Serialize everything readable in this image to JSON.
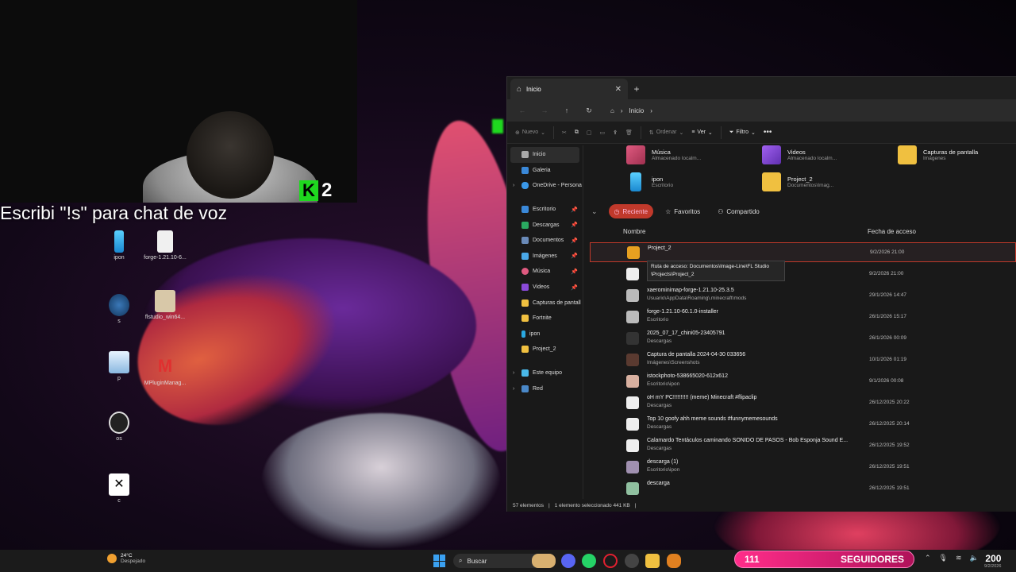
{
  "overlay": {
    "chat_text": "Escribi \"!s\" para chat de voz",
    "k_number": "2",
    "followers_count": "111",
    "followers_label": "SEGUIDORES",
    "right_count": "200"
  },
  "desktop": {
    "icons": [
      {
        "label": "ipon"
      },
      {
        "label": "forge-1.21.10-6..."
      },
      {
        "label": "s"
      },
      {
        "label": "flstudio_win64..."
      },
      {
        "label": "p"
      },
      {
        "label": "MPluginManag..."
      },
      {
        "label": "os"
      },
      {
        "label": "c"
      }
    ]
  },
  "explorer": {
    "tab_title": "Inicio",
    "breadcrumb": "Inicio",
    "toolbar": {
      "new": "Nuevo",
      "sort": "Ordenar",
      "view": "Ver",
      "filter": "Filtro"
    },
    "sidebar": {
      "items": [
        {
          "label": "Inicio",
          "pinned": false
        },
        {
          "label": "Galeria",
          "pinned": false
        },
        {
          "label": "OneDrive - Persona",
          "pinned": false
        },
        {
          "label": "Escritorio",
          "pinned": true
        },
        {
          "label": "Descargas",
          "pinned": true
        },
        {
          "label": "Documentos",
          "pinned": true
        },
        {
          "label": "Imágenes",
          "pinned": true
        },
        {
          "label": "Música",
          "pinned": true
        },
        {
          "label": "Videos",
          "pinned": true
        },
        {
          "label": "Capturas de pantall",
          "pinned": false
        },
        {
          "label": "Fortnite",
          "pinned": false
        },
        {
          "label": "ipon",
          "pinned": false
        },
        {
          "label": "Project_2",
          "pinned": false
        },
        {
          "label": "Este equipo",
          "pinned": false
        },
        {
          "label": "Red",
          "pinned": false
        }
      ]
    },
    "quick_access": [
      {
        "name": "Música",
        "sub": "Almacenado localm...",
        "color": "#c0407a"
      },
      {
        "name": "Videos",
        "sub": "Almacenado localm...",
        "color": "#8a3ad8"
      },
      {
        "name": "Capturas de pantalla",
        "sub": "Imágenes",
        "color": "#f0c040"
      },
      {
        "name": "ipon",
        "sub": "Escritorio",
        "color": "#2aa8e0"
      },
      {
        "name": "Project_2",
        "sub": "Documentos\\Imag...",
        "color": "#f0c040"
      }
    ],
    "filters": {
      "recent": "Reciente",
      "favorites": "Favoritos",
      "shared": "Compartido"
    },
    "columns": {
      "name": "Nombre",
      "date": "Fecha de acceso"
    },
    "files": [
      {
        "name": "Project_2",
        "location": "",
        "date": "9/2/2026 21:00",
        "color": "#e8a020"
      },
      {
        "name": "",
        "location": "Documentos\\Image-Line\\FL Studio\\Projects\\Project_2",
        "date": "9/2/2026 21:00",
        "color": "#eeeeee"
      },
      {
        "name": "xaerominimap-forge-1.21.10-25.3.5",
        "location": "Usuario\\AppData\\Roaming\\.minecraft\\mods",
        "date": "29/1/2026 14:47",
        "color": "#bbbbbb"
      },
      {
        "name": "forge-1.21.10-60.1.0-installer",
        "location": "Escritorio",
        "date": "26/1/2026 15:17",
        "color": "#bbbbbb"
      },
      {
        "name": "2025_07_17_chini05-23405791",
        "location": "Descargas",
        "date": "26/1/2026 00:09",
        "color": "#333333"
      },
      {
        "name": "Captura de pantalla 2024-04-30 033656",
        "location": "Imágenes\\Screenshots",
        "date": "10/1/2026 01:19",
        "color": "#5a3a30"
      },
      {
        "name": "istockphoto-538665020-612x612",
        "location": "Escritorio\\ipon",
        "date": "9/1/2026 00:08",
        "color": "#d8b0a0"
      },
      {
        "name": "oH mY PC!!!!!!!!!! (meme) Minecraft #flipaclip",
        "location": "Descargas",
        "date": "26/12/2025 20:22",
        "color": "#eeeeee"
      },
      {
        "name": "Top 10 goofy ahh meme sounds #funnymemesounds",
        "location": "Descargas",
        "date": "26/12/2025 20:14",
        "color": "#eeeeee"
      },
      {
        "name": "Calamardo Tentáculos caminando  SONIDO DE PASOS  - Bob Esponja  Sound E...",
        "location": "Descargas",
        "date": "26/12/2025 19:52",
        "color": "#eeeeee"
      },
      {
        "name": "descarga (1)",
        "location": "Escritorio\\ipon",
        "date": "26/12/2025 19:51",
        "color": "#a090b0"
      },
      {
        "name": "descarga",
        "location": "",
        "date": "26/12/2025 19:51",
        "color": "#90c0a0"
      }
    ],
    "tooltip": {
      "line1": "Ruta de acceso: Documentos\\Image-Line\\FL Studio",
      "line2": "\\Projects\\Project_2"
    },
    "status": {
      "count": "57 elementos",
      "selection": "1 elemento seleccionado  441 KB"
    }
  },
  "taskbar": {
    "temperature": "24°C",
    "weather": "Despejado",
    "search_placeholder": "Buscar",
    "clock_date": "9/2/2026"
  }
}
